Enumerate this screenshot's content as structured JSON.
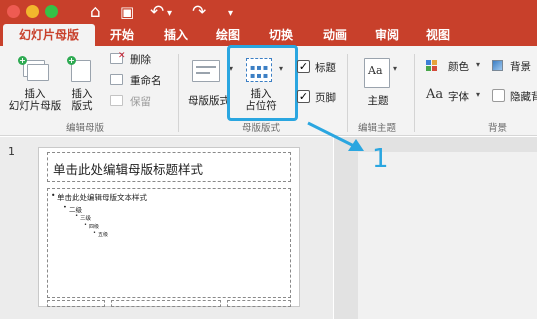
{
  "colors": {
    "brand": "#c8402b",
    "ribbon_bg": "#f3f3f3",
    "highlight": "#2aa6e0",
    "plus_green": "#2eaa52"
  },
  "titlebar": {
    "icons": [
      "home-icon",
      "save-icon",
      "undo-icon",
      "redo-icon",
      "more-icon"
    ],
    "home_glyph": "⌂",
    "save_glyph": "▣",
    "undo_glyph": "↶",
    "redo_glyph": "↷",
    "more_glyph": "▾"
  },
  "tabs": [
    "幻灯片母版",
    "开始",
    "插入",
    "绘图",
    "切换",
    "动画",
    "审阅",
    "视图"
  ],
  "ribbon": {
    "insert_slide_master": "插入\n幻灯片母版",
    "insert_layout": "插入\n版式",
    "delete": "删除",
    "rename": "重命名",
    "preserve": "保留",
    "group_edit_master": "编辑母版",
    "master_layout": "母版版式",
    "insert_placeholder": "插入\n占位符",
    "title_check": "标题",
    "footer_check": "页脚",
    "group_master_layout": "母版版式",
    "themes": "主题",
    "group_edit_theme": "编辑主题",
    "colors": "颜色",
    "fonts": "字体",
    "background_styles": "背景",
    "hide_background": "隐藏背",
    "group_background": "背景",
    "check_glyph": "✓",
    "font_glyph": "Aa",
    "theme_glyph": "Aa"
  },
  "thumbnails": {
    "number": "1"
  },
  "slide_master": {
    "title": "单击此处编辑母版标题样式",
    "body_level1": "单击此处编辑母版文本样式",
    "body_level2": "二级",
    "body_level3": "三级",
    "body_level4": "四级",
    "body_level5": "五级",
    "bullet": "•"
  },
  "annotation": {
    "number": "1"
  }
}
